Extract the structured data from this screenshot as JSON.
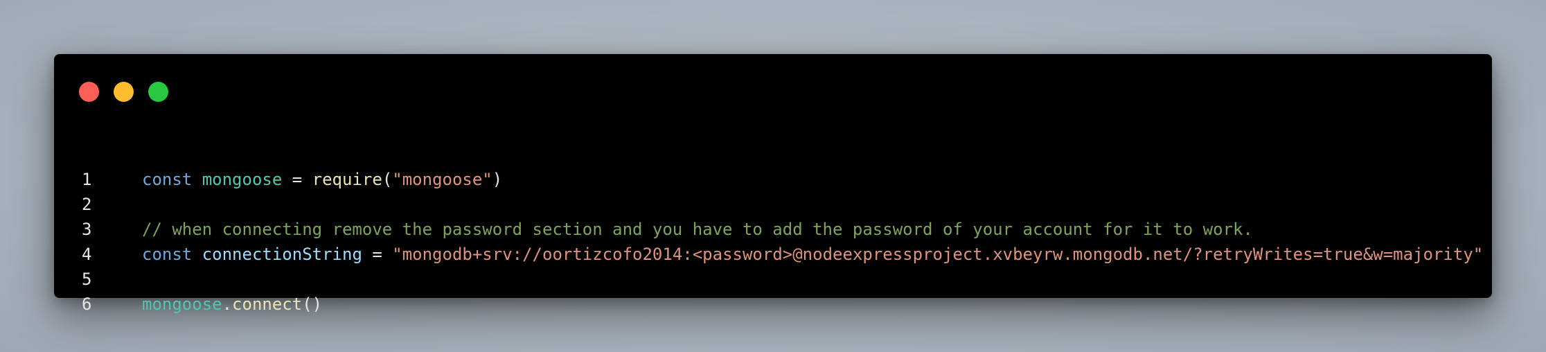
{
  "window": {
    "controls": [
      {
        "name": "close",
        "color": "#ff5f57"
      },
      {
        "name": "minimize",
        "color": "#febc2e"
      },
      {
        "name": "zoom",
        "color": "#28c840"
      }
    ]
  },
  "colors": {
    "keyword": "#6fa8dc",
    "variable": "#4ec9b0",
    "identifier": "#9cdcfe",
    "function": "#e9e5b3",
    "string": "#e0937a",
    "comment": "#7da55a",
    "punctuation": "#e6e6e6"
  },
  "code": {
    "lines": [
      {
        "number": "1",
        "tokens": [
          {
            "text": "const",
            "kind": "keyword"
          },
          {
            "text": " ",
            "kind": "punctuation"
          },
          {
            "text": "mongoose",
            "kind": "variable"
          },
          {
            "text": " = ",
            "kind": "punctuation"
          },
          {
            "text": "require",
            "kind": "function"
          },
          {
            "text": "(",
            "kind": "punctuation"
          },
          {
            "text": "\"mongoose\"",
            "kind": "string"
          },
          {
            "text": ")",
            "kind": "punctuation"
          }
        ]
      },
      {
        "number": "2",
        "tokens": []
      },
      {
        "number": "3",
        "tokens": [
          {
            "text": "// when connecting remove the password section and you have to add the password of your account for it to work.",
            "kind": "comment"
          }
        ]
      },
      {
        "number": "4",
        "tokens": [
          {
            "text": "const",
            "kind": "keyword"
          },
          {
            "text": " ",
            "kind": "punctuation"
          },
          {
            "text": "connectionString",
            "kind": "identifier"
          },
          {
            "text": " = ",
            "kind": "punctuation"
          },
          {
            "text": "\"mongodb+srv://oortizcofo2014:<password>@nodeexpressproject.xvbeyrw.mongodb.net/?retryWrites=true&w=majority\"",
            "kind": "string"
          }
        ]
      },
      {
        "number": "5",
        "tokens": []
      },
      {
        "number": "6",
        "tokens": [
          {
            "text": "mongoose",
            "kind": "variable"
          },
          {
            "text": ".",
            "kind": "punctuation"
          },
          {
            "text": "connect",
            "kind": "function"
          },
          {
            "text": "()",
            "kind": "punctuation"
          }
        ]
      }
    ]
  }
}
